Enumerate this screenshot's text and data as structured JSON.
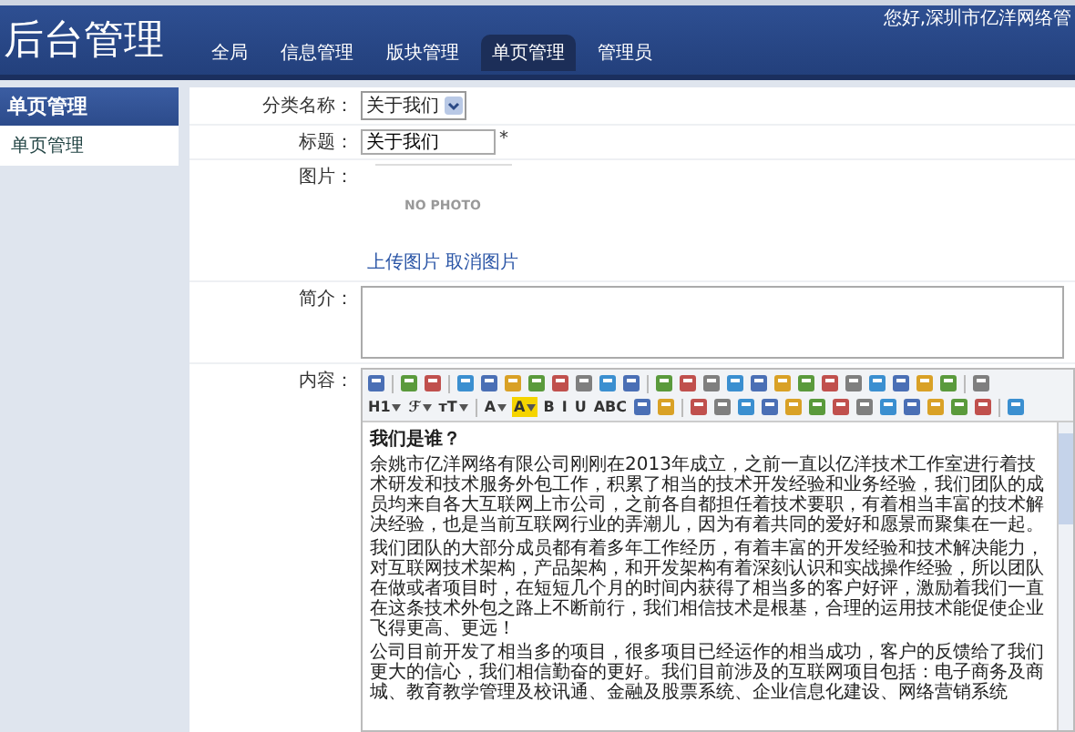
{
  "header": {
    "title": "后台管理",
    "user_info": "您好,深圳市亿洋网络管",
    "nav": [
      {
        "label": "全局",
        "selected": false
      },
      {
        "label": "信息管理",
        "selected": false
      },
      {
        "label": "版块管理",
        "selected": false
      },
      {
        "label": "单页管理",
        "selected": true
      },
      {
        "label": "管理员",
        "selected": false
      }
    ]
  },
  "sidebar": {
    "heading": "单页管理",
    "items": [
      {
        "label": "单页管理",
        "selected": false
      }
    ]
  },
  "form": {
    "category": {
      "label": "分类名称：",
      "value": "关于我们"
    },
    "title": {
      "label": "标题：",
      "value": "关于我们",
      "required_mark": "*"
    },
    "image": {
      "label": "图片：",
      "placeholder_text": "NO PHOTO",
      "links": [
        "上传图片",
        "取消图片"
      ]
    },
    "summary": {
      "label": "简介："
    },
    "content": {
      "label": "内容：",
      "toolbar": [
        [
          {
            "kind": "icon"
          },
          {
            "kind": "sep"
          },
          {
            "kind": "icon"
          },
          {
            "kind": "icon"
          },
          {
            "kind": "sep"
          },
          {
            "kind": "icon"
          },
          {
            "kind": "icon"
          },
          {
            "kind": "icon"
          },
          {
            "kind": "icon"
          },
          {
            "kind": "icon"
          },
          {
            "kind": "icon"
          },
          {
            "kind": "icon"
          },
          {
            "kind": "icon"
          },
          {
            "kind": "sep"
          },
          {
            "kind": "icon"
          },
          {
            "kind": "icon"
          },
          {
            "kind": "icon"
          },
          {
            "kind": "icon"
          },
          {
            "kind": "icon"
          },
          {
            "kind": "icon"
          },
          {
            "kind": "icon"
          },
          {
            "kind": "icon"
          },
          {
            "kind": "icon"
          },
          {
            "kind": "icon"
          },
          {
            "kind": "icon"
          },
          {
            "kind": "icon"
          },
          {
            "kind": "icon"
          },
          {
            "kind": "sep"
          },
          {
            "kind": "icon"
          }
        ],
        [
          {
            "kind": "text",
            "label": "H1",
            "dropdown": true,
            "highlight": false
          },
          {
            "kind": "text",
            "label": "ℱ",
            "dropdown": true,
            "highlight": false
          },
          {
            "kind": "text",
            "label": "тT",
            "dropdown": true,
            "highlight": false
          },
          {
            "kind": "sep"
          },
          {
            "kind": "text",
            "label": "A",
            "dropdown": true,
            "highlight": false
          },
          {
            "kind": "text",
            "label": "A",
            "dropdown": true,
            "highlight": true
          },
          {
            "kind": "text",
            "label": "B",
            "dropdown": false,
            "highlight": false
          },
          {
            "kind": "text",
            "label": "I",
            "dropdown": false,
            "highlight": false
          },
          {
            "kind": "text",
            "label": "U",
            "dropdown": false,
            "highlight": false
          },
          {
            "kind": "text",
            "label": "ABC",
            "dropdown": false,
            "highlight": false
          },
          {
            "kind": "icon"
          },
          {
            "kind": "icon"
          },
          {
            "kind": "sep"
          },
          {
            "kind": "icon"
          },
          {
            "kind": "icon"
          },
          {
            "kind": "icon"
          },
          {
            "kind": "icon"
          },
          {
            "kind": "icon"
          },
          {
            "kind": "icon"
          },
          {
            "kind": "icon"
          },
          {
            "kind": "icon"
          },
          {
            "kind": "icon"
          },
          {
            "kind": "icon"
          },
          {
            "kind": "icon"
          },
          {
            "kind": "icon"
          },
          {
            "kind": "icon"
          },
          {
            "kind": "sep"
          },
          {
            "kind": "icon"
          }
        ]
      ],
      "heading": "我们是谁？",
      "paragraphs": [
        "余姚市亿洋网络有限公司刚刚在2013年成立，之前一直以亿洋技术工作室进行着技术研发和技术服务外包工作，积累了相当的技术开发经验和业务经验，我们团队的成员均来自各大互联网上市公司，之前各自都担任着技术要职，有着相当丰富的技术解决经验，也是当前互联网行业的弄潮儿，因为有着共同的爱好和愿景而聚集在一起。",
        "我们团队的大部分成员都有着多年工作经历，有着丰富的开发经验和技术解决能力，对互联网技术架构，产品架构，和开发架构有着深刻认识和实战操作经验，所以团队在做或者项目时，在短短几个月的时间内获得了相当多的客户好评，激励着我们一直在这条技术外包之路上不断前行，我们相信技术是根基，合理的运用技术能促使企业飞得更高、更远！",
        "公司目前开发了相当多的项目，很多项目已经运作的相当成功，客户的反馈给了我们更大的信心，我们相信勤奋的更好。我们目前涉及的互联网项目包括：电子商务及商城、教育教学管理及校讯通、金融及股票系统、企业信息化建设、网络营销系统"
      ]
    }
  }
}
